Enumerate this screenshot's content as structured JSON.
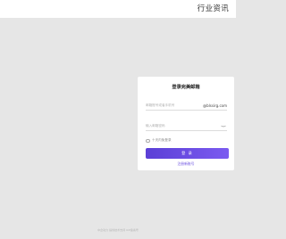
{
  "header": {
    "title": "行业资讯"
  },
  "login": {
    "heading": "登录完美邮箱",
    "account_placeholder": "邮箱账号或者手机号",
    "domain_suffix": "@blssirg.com",
    "password_placeholder": "输入邮箱密码",
    "remember_label": "十天内免登录",
    "submit_label": "登 录",
    "register_link": "注册新账号"
  },
  "footer": {
    "text": "中企动力 提供技术支持 ICP备案号"
  }
}
